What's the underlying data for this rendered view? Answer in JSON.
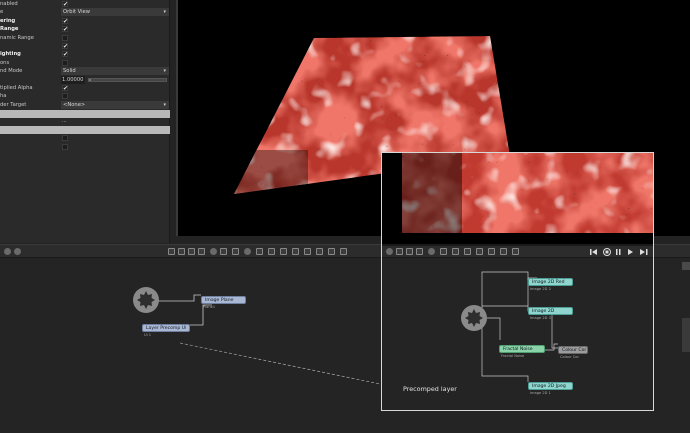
{
  "properties": {
    "rows": [
      {
        "label": "nabled",
        "kind": "check",
        "checked": true
      },
      {
        "label": "e",
        "kind": "drop",
        "value": "Orbit View"
      },
      {
        "label": "ering",
        "kind": "check",
        "checked": true,
        "section": true
      },
      {
        "label": "Range",
        "kind": "check",
        "checked": true,
        "section": true
      },
      {
        "label": "namic Range",
        "kind": "check",
        "checked": false
      },
      {
        "label": "",
        "kind": "check",
        "checked": true
      },
      {
        "label": "ighting",
        "kind": "check",
        "checked": true,
        "section": true
      },
      {
        "label": "ons",
        "kind": "check",
        "checked": false
      },
      {
        "label": "nd Mode",
        "kind": "drop",
        "value": "Solid"
      },
      {
        "label": "",
        "kind": "num",
        "value": "1.00000"
      },
      {
        "label": "tiplied Alpha",
        "kind": "check",
        "checked": true
      },
      {
        "label": "ha",
        "kind": "check",
        "checked": false
      },
      {
        "label": "der Target",
        "kind": "drop",
        "value": "<None>"
      }
    ],
    "check_mark": "✔",
    "dash": "...",
    "trailing_checks": [
      false,
      false
    ]
  },
  "toolbar": {
    "icons": [
      "link-icon",
      "node-icon",
      "copy-icon",
      "layers-icon",
      "grid-icon",
      "gear-icon",
      "eye-icon",
      "filter-icon"
    ]
  },
  "inset_toolbar": {
    "right_icons": [
      "skip-back-icon",
      "stop-icon",
      "pause-icon",
      "play-icon",
      "skip-forward-icon"
    ]
  },
  "graph": {
    "nodes": {
      "plane": {
        "label": "Image   Plane",
        "sub": "Plane1"
      },
      "layer": {
        "label": "Layer   Precomp   Ui",
        "sub": "Ui 1"
      }
    }
  },
  "inset_graph": {
    "nodes": {
      "red": {
        "label": "Image   2D     Red",
        "sub": "Image 2D 2"
      },
      "image2d": {
        "label": "Image   2D",
        "sub": "Image 2D 3"
      },
      "fractal": {
        "label": "Fractal   Noise",
        "sub": "Fractal Noise"
      },
      "colour": {
        "label": "Colour   Cor",
        "sub": "Colour Cor"
      },
      "jpeg": {
        "label": "Image   2D      Jpeg",
        "sub": "Image 2D 1"
      }
    }
  },
  "caption": "Precomped layer"
}
